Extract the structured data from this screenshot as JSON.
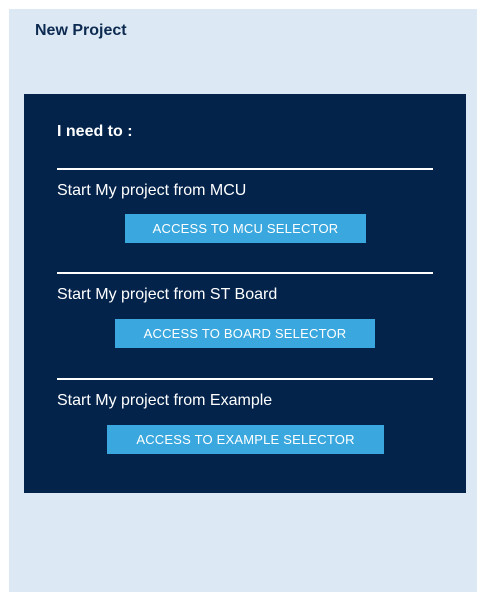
{
  "panel": {
    "title": "New Project"
  },
  "card": {
    "heading": "I need to :",
    "sections": [
      {
        "label": "Start My project from MCU",
        "button_label": "ACCESS TO MCU SELECTOR"
      },
      {
        "label": "Start My project from ST Board",
        "button_label": "ACCESS TO BOARD SELECTOR"
      },
      {
        "label": "Start My project from Example",
        "button_label": "ACCESS TO EXAMPLE SELECTOR"
      }
    ]
  },
  "colors": {
    "panel_background": "#dce9f5",
    "card_background": "#03234b",
    "button_background": "#3aa8de",
    "title_text": "#0d2a50"
  }
}
